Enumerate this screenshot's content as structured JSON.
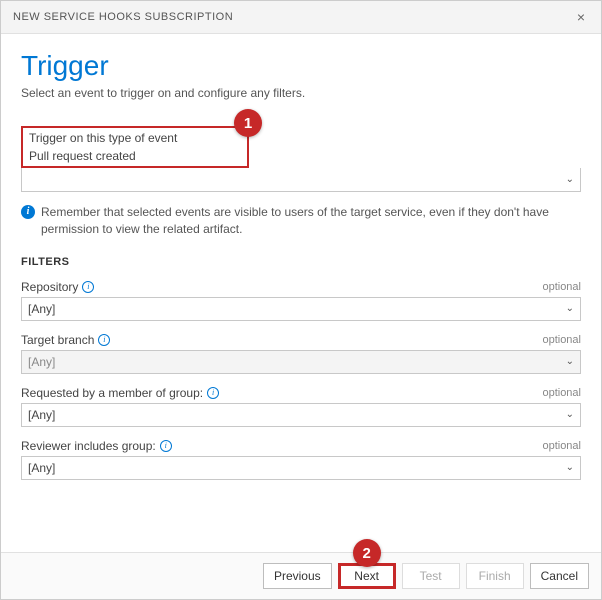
{
  "titlebar": {
    "title": "NEW SERVICE HOOKS SUBSCRIPTION"
  },
  "header": {
    "title": "Trigger",
    "subtitle": "Select an event to trigger on and configure any filters."
  },
  "annotations": {
    "badge1": "1",
    "badge2": "2"
  },
  "event": {
    "label": "Trigger on this type of event",
    "value": "Pull request created"
  },
  "info": {
    "text": "Remember that selected events are visible to users of the target service, even if they don't have permission to view the related artifact."
  },
  "filters": {
    "heading": "FILTERS",
    "optional_label": "optional",
    "items": [
      {
        "label": "Repository",
        "value": "[Any]",
        "info": true,
        "disabled": false
      },
      {
        "label": "Target branch",
        "value": "[Any]",
        "info": true,
        "disabled": true
      },
      {
        "label": "Requested by a member of group:",
        "value": "[Any]",
        "info": true,
        "disabled": false
      },
      {
        "label": "Reviewer includes group:",
        "value": "[Any]",
        "info": true,
        "disabled": false
      }
    ]
  },
  "footer": {
    "previous": "Previous",
    "next": "Next",
    "test": "Test",
    "finish": "Finish",
    "cancel": "Cancel"
  }
}
